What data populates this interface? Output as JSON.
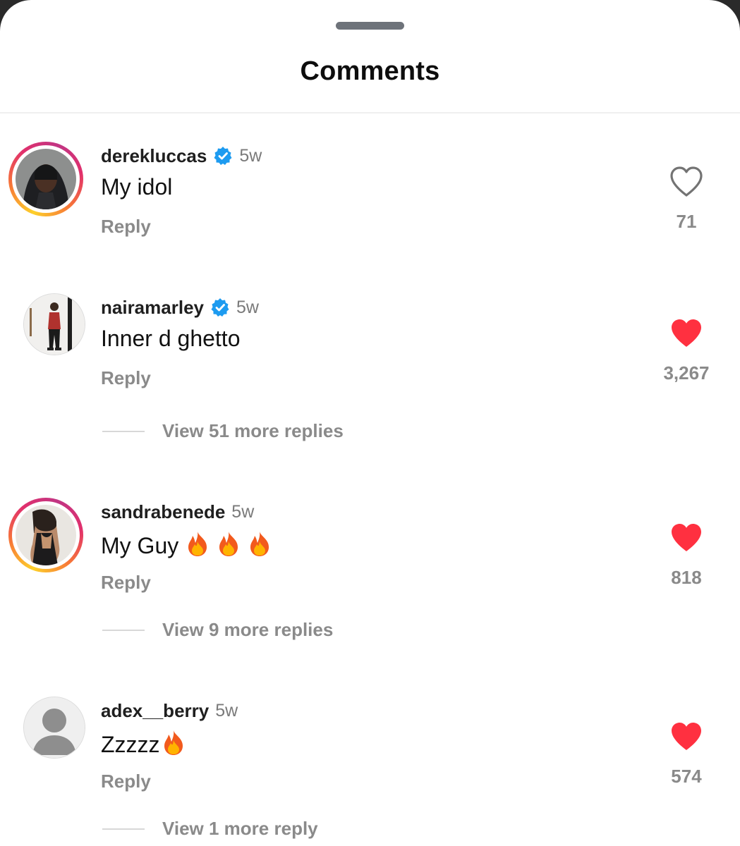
{
  "sheet": {
    "title": "Comments"
  },
  "comments": [
    {
      "username": "derekluccas",
      "verified": true,
      "time": "5w",
      "text": "My idol",
      "reply_label": "Reply",
      "liked": false,
      "likes": "71",
      "avatar": "hooded-man-photo"
    },
    {
      "username": "nairamarley",
      "verified": true,
      "time": "5w",
      "text": "Inner d ghetto",
      "reply_label": "Reply",
      "liked": true,
      "likes": "3,267",
      "avatar": "standing-man-photo",
      "more_replies": "View 51 more replies"
    },
    {
      "username": "sandrabenede",
      "verified": false,
      "time": "5w",
      "text": "My Guy",
      "emoji": "fire x3",
      "reply_label": "Reply",
      "liked": true,
      "likes": "818",
      "avatar": "woman-photo",
      "more_replies": "View 9 more replies"
    },
    {
      "username": "adex__berry",
      "verified": false,
      "time": "5w",
      "text": "Zzzzz",
      "emoji": "fire x1",
      "reply_label": "Reply",
      "liked": true,
      "likes": "574",
      "avatar": "default-person-icon",
      "more_replies": "View 1 more reply"
    }
  ],
  "colors": {
    "liked_heart": "#ff3040",
    "verified_badge": "#1d9bf0",
    "secondary_text": "#8a8a8a"
  }
}
